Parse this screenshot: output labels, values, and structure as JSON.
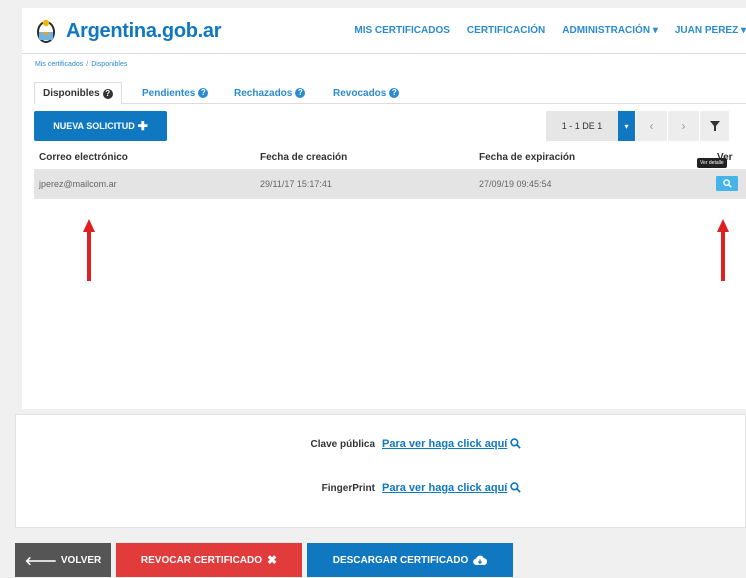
{
  "header": {
    "brand": "Argentina.gob.ar",
    "nav": [
      {
        "label": "MIS CERTIFICADOS"
      },
      {
        "label": "CERTIFICACIÓN"
      },
      {
        "label": "ADMINISTRACIÓN ▾"
      },
      {
        "label": "JUAN PEREZ ▾"
      }
    ]
  },
  "breadcrumb": {
    "items": [
      "Mis certificados",
      "Disponibles"
    ],
    "separator": "/"
  },
  "tabs": [
    {
      "label": "Disponibles",
      "active": true
    },
    {
      "label": "Pendientes"
    },
    {
      "label": "Rechazados"
    },
    {
      "label": "Revocados"
    }
  ],
  "toolbar": {
    "new_request_label": "NUEVA SOLICITUD"
  },
  "pagination": {
    "range": "1 - 1 DE 1"
  },
  "table": {
    "columns": [
      "Correo electrónico",
      "Fecha de creación",
      "Fecha de expiración",
      "Ver"
    ],
    "rows": [
      {
        "email": "jperez@mailcom.ar",
        "created": "29/11/17 15:17:41",
        "expires": "27/09/19 09:45:54"
      }
    ],
    "tooltip": "Ver detalle"
  },
  "keys": {
    "public_key_label": "Clave pública",
    "public_key_link": "Para ver haga click aquí",
    "fingerprint_label": "FingerPrint",
    "fingerprint_link": "Para ver haga click aquí"
  },
  "actions": {
    "back_label": "VOLVER",
    "revoke_label": "REVOCAR CERTIFICADO",
    "download_label": "DESCARGAR CERTIFICADO"
  },
  "colors": {
    "primary": "#0f78c0",
    "link": "#2b8bd1",
    "danger": "#e23b3b",
    "view_button": "#46b4e8",
    "arrow": "#e02020"
  },
  "icons": {
    "brand": "escudo-icon",
    "tab_help": "question-circle-icon",
    "new_request": "plus-icon",
    "view": "search-icon",
    "back": "arrow-left-icon",
    "revoke": "times-icon",
    "download": "cloud-download-icon"
  }
}
